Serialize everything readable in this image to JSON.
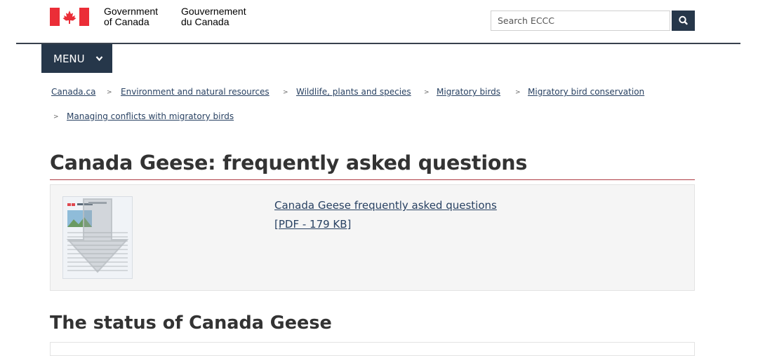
{
  "header": {
    "signature_en_line1": "Government",
    "signature_en_line2": "of Canada",
    "signature_fr_line1": "Gouvernement",
    "signature_fr_line2": "du Canada",
    "search_placeholder": "Search ECCC",
    "flag_color": "#eb2d37"
  },
  "menu": {
    "label": "MENU"
  },
  "breadcrumb": {
    "separator": ">",
    "items": [
      "Canada.ca",
      "Environment and natural resources",
      "Wildlife, plants and species",
      "Migratory birds",
      "Migratory bird conservation",
      "Managing conflicts with migratory birds"
    ]
  },
  "main": {
    "title": "Canada Geese: frequently asked questions",
    "document": {
      "link_text": "Canada Geese frequently asked questions",
      "file_info": "[PDF - 179 KB]"
    },
    "section_heading": "The status of Canada Geese"
  },
  "colors": {
    "navy": "#26374a",
    "link": "#284162",
    "title_rule": "#af3c43"
  }
}
